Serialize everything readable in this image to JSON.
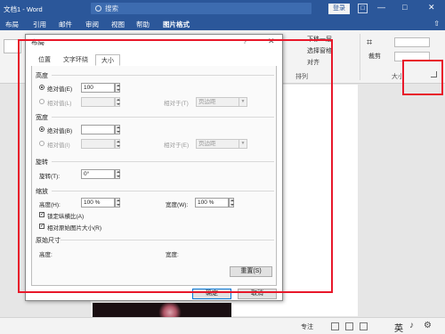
{
  "app": {
    "doc_title": "文档1 - Word",
    "search_placeholder": "搜索",
    "login_label": "登录",
    "restore_box": "□",
    "min_btn": "—",
    "max_btn": "□",
    "close_btn": "✕"
  },
  "ribbon": {
    "tabs": [
      "布局",
      "引用",
      "邮件",
      "审阅",
      "视图",
      "帮助",
      "图片格式"
    ],
    "active_tab": "图片格式",
    "share_glyph": "⇧",
    "arrange_items": [
      "下移一层",
      "选择窗格",
      "对齐"
    ],
    "arrange_group": "排列",
    "crop_label": "裁剪",
    "size_group": "大小"
  },
  "dialog": {
    "title": "布局",
    "help_glyph": "?",
    "close_glyph": "✕",
    "tabs": [
      "位置",
      "文字环绕",
      "大小"
    ],
    "active_tab": "大小",
    "height": {
      "section": "高度",
      "absolute_label": "绝对值(E)",
      "absolute_value": "100",
      "relative_label": "相对值(L)",
      "relative_to_label": "相对于(T)",
      "relative_to_value": "页边距"
    },
    "width": {
      "section": "宽度",
      "absolute_label": "绝对值(B)",
      "relative_label": "相对值(I)",
      "relative_to_label": "相对于(E)",
      "relative_to_value": "页边距"
    },
    "rotate": {
      "section": "旋转",
      "label": "旋转(T):",
      "value": "0°"
    },
    "scale": {
      "section": "缩放",
      "height_label": "高度(H):",
      "height_value": "100 %",
      "width_label": "宽度(W):",
      "width_value": "100 %",
      "lock_label": "锁定纵横比(A)",
      "relative_label": "相对原始图片大小(R)",
      "check_mark": "✓"
    },
    "original": {
      "section": "原始尺寸",
      "height_label": "高度:",
      "width_label": "宽度:"
    },
    "reset_label": "重置(S)",
    "ok_label": "确定",
    "cancel_label": "取消"
  },
  "status": {
    "focus_label": "专注",
    "ime": "英",
    "ime_symbols": [
      "♪",
      "⚙"
    ]
  },
  "colors": {
    "word_blue": "#2b579a",
    "annotation_red": "#e8182a"
  }
}
